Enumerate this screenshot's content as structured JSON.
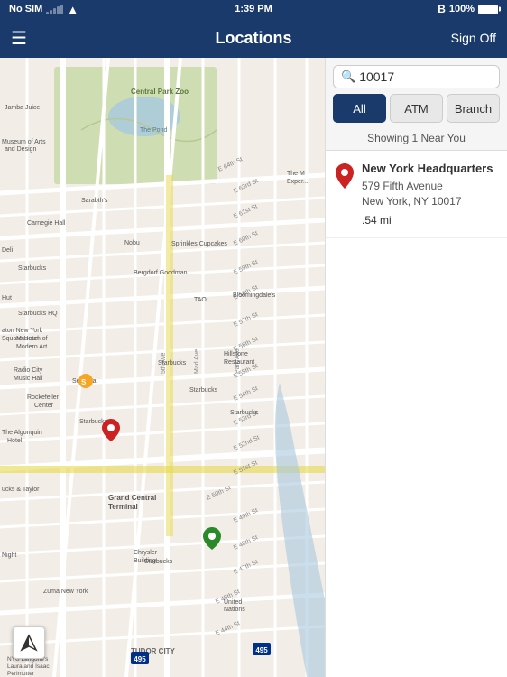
{
  "statusBar": {
    "carrier": "No SIM",
    "time": "1:39 PM",
    "battery": "100%",
    "bluetooth": "BT"
  },
  "navBar": {
    "title": "Locations",
    "menuIcon": "☰",
    "signOffLabel": "Sign Off"
  },
  "rightPanel": {
    "search": {
      "value": "10017",
      "placeholder": "Search"
    },
    "filters": [
      {
        "label": "All",
        "active": true
      },
      {
        "label": "ATM",
        "active": false
      },
      {
        "label": "Branch",
        "active": false
      }
    ],
    "showingText": "Showing 1 Near You",
    "results": [
      {
        "name": "New York Headquarters",
        "address1": "579 Fifth Avenue",
        "address2": "New York, NY 10017",
        "distance": ".54 mi"
      }
    ]
  },
  "map": {
    "locateButtonTitle": "Locate"
  }
}
